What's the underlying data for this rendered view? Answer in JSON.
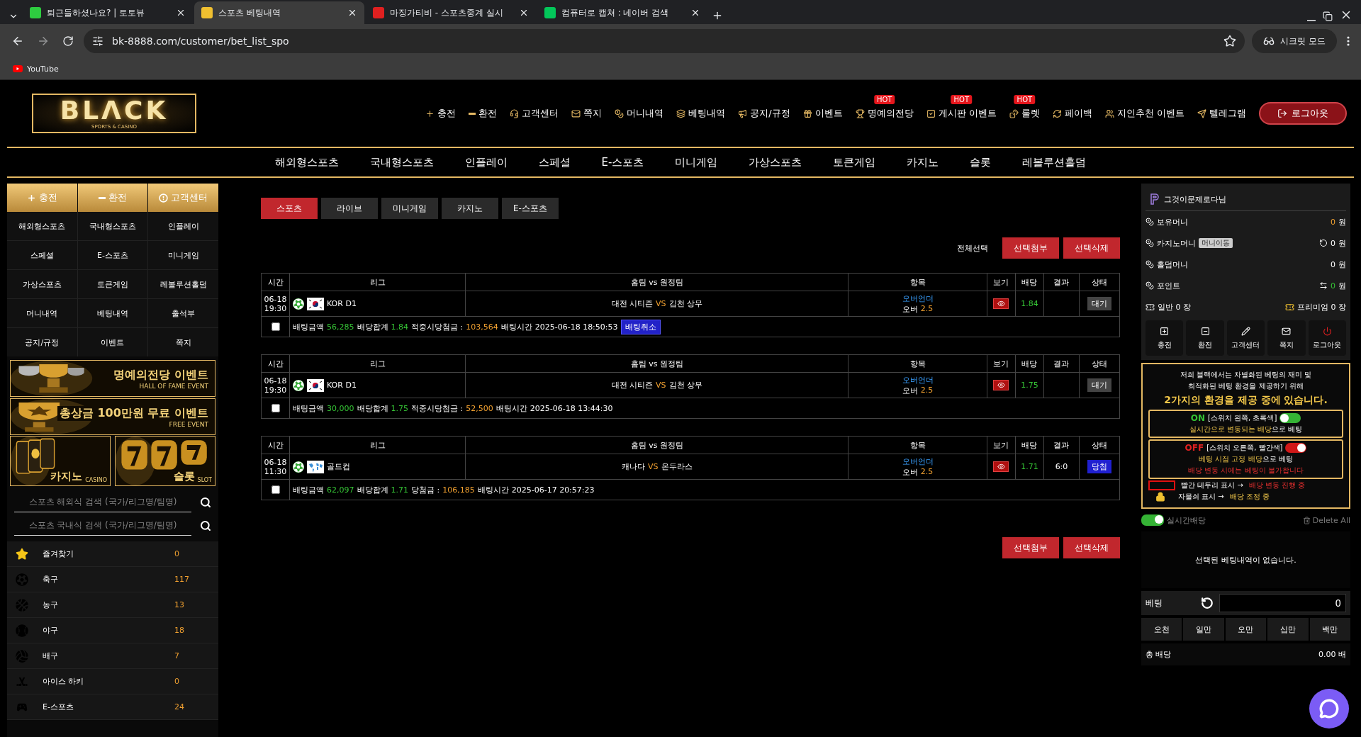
{
  "browser": {
    "tabs": [
      {
        "title": "퇴근들하셨나요? | 토토뷰",
        "selected": false
      },
      {
        "title": "스포츠 베팅내역",
        "selected": true
      },
      {
        "title": "마징가티비 - 스포츠중계 실시",
        "selected": false
      },
      {
        "title": "컴퓨터로 캡쳐 : 네이버 검색",
        "selected": false
      }
    ],
    "url": "bk-8888.com/customer/bet_list_spo",
    "profile": "시크릿 모드",
    "bookmarks": [
      "YouTube"
    ]
  },
  "header": {
    "logo": "BLΛCK",
    "logo_sub": "SPORTS & CASINO",
    "menu": [
      {
        "label": "충전"
      },
      {
        "label": "환전"
      },
      {
        "label": "고객센터"
      },
      {
        "label": "쪽지"
      },
      {
        "label": "머니내역"
      },
      {
        "label": "베팅내역"
      },
      {
        "label": "공지/규정"
      },
      {
        "label": "이벤트"
      },
      {
        "label": "명예의전당",
        "badge": "HOT"
      },
      {
        "label": "게시판 이벤트",
        "badge": "HOT"
      },
      {
        "label": "룰렛",
        "badge": "HOT"
      },
      {
        "label": "페이백"
      },
      {
        "label": "지인추천 이벤트"
      },
      {
        "label": "텔레그램"
      }
    ],
    "logout": "로그아웃",
    "nav": [
      "해외형스포츠",
      "국내형스포츠",
      "인플레이",
      "스페셜",
      "E-스포츠",
      "미니게임",
      "가상스포츠",
      "토큰게임",
      "카지노",
      "슬롯",
      "레볼루션홀덤"
    ]
  },
  "left": {
    "quick": [
      "충전",
      "환전",
      "고객센터"
    ],
    "grid": [
      "해외형스포츠",
      "국내형스포츠",
      "인플레이",
      "스페셜",
      "E-스포츠",
      "미니게임",
      "가상스포츠",
      "토큰게임",
      "레볼루션홀덤",
      "머니내역",
      "베팅내역",
      "출석부",
      "공지/규정",
      "이벤트",
      "쪽지"
    ],
    "banners": [
      {
        "title": "명예의전당 이벤트",
        "sub": "HALL OF FAME EVENT"
      },
      {
        "title": "총상금 100만원 무료 이벤트",
        "sub": "FREE EVENT"
      }
    ],
    "tiles": [
      {
        "title": "카지노",
        "sub": "CASINO"
      },
      {
        "title": "슬롯",
        "sub": "SLOT"
      }
    ],
    "searches": [
      {
        "placeholder": "스포츠 해외식 검색 (국가/리그명/팀명)"
      },
      {
        "placeholder": "스포츠 국내식 검색 (국가/리그명/팀명)"
      }
    ],
    "sports": [
      {
        "name": "즐겨찾기",
        "count": "0"
      },
      {
        "name": "축구",
        "count": "117"
      },
      {
        "name": "농구",
        "count": "13"
      },
      {
        "name": "야구",
        "count": "18"
      },
      {
        "name": "배구",
        "count": "7"
      },
      {
        "name": "아이스 하키",
        "count": "0"
      },
      {
        "name": "E-스포츠",
        "count": "24"
      }
    ]
  },
  "main": {
    "tabs": [
      {
        "label": "스포츠",
        "selected": true
      },
      {
        "label": "라이브",
        "selected": false
      },
      {
        "label": "미니게임",
        "selected": false
      },
      {
        "label": "카지노",
        "selected": false
      },
      {
        "label": "E-스포츠",
        "selected": false
      }
    ],
    "select_all": "전체선택",
    "actions": [
      "선택첨부",
      "선택삭제"
    ],
    "bets": [
      {
        "columns": [
          "시간",
          "리그",
          "홈팀 vs 원정팀",
          "항목",
          "보기",
          "배당",
          "결과",
          "상태"
        ],
        "kind": "pending",
        "flag": {
          "kind": "kr"
        },
        "date": "06-18",
        "time": "19:30",
        "league": "KOR D1",
        "home": "대전 시티즌",
        "vs": "VS",
        "away": "김천 상무",
        "market": "오버언더",
        "pick": "오버",
        "line": "2.5",
        "odds": "1.84",
        "status": "대기",
        "checked": false,
        "amount_label": "배팅금액",
        "amount": "56,285",
        "sum_label": "배당합계",
        "sum": "1.84",
        "payout_label": "적중시당첨금 :",
        "payout": "103,564",
        "time_label": "배팅시간",
        "bet_time": "2025-06-18 18:50:53",
        "cancel": "배팅취소"
      },
      {
        "columns": [
          "시간",
          "리그",
          "홈팀 vs 원정팀",
          "항목",
          "보기",
          "배당",
          "결과",
          "상태"
        ],
        "kind": "pending",
        "flag": {
          "kind": "kr"
        },
        "date": "06-18",
        "time": "19:30",
        "league": "KOR D1",
        "home": "대전 시티즌",
        "vs": "VS",
        "away": "김천 상무",
        "market": "오버언더",
        "pick": "오버",
        "line": "2.5",
        "odds": "1.75",
        "status": "대기",
        "checked": false,
        "amount_label": "배팅금액",
        "amount": "30,000",
        "sum_label": "배당합계",
        "sum": "1.75",
        "payout_label": "적중시당첨금 :",
        "payout": "52,500",
        "time_label": "배팅시간",
        "bet_time": "2025-06-18 13:44:30"
      },
      {
        "columns": [
          "시간",
          "리그",
          "홈팀 vs 원정팀",
          "항목",
          "보기",
          "배당",
          "결과",
          "상태"
        ],
        "kind": "won",
        "flag": {
          "kind": "world"
        },
        "date": "06-18",
        "time": "11:30",
        "league": "골드컵",
        "home": "캐나다",
        "vs": "VS",
        "away": "온두라스",
        "market": "오버언더",
        "pick": "오버",
        "line": "2.5",
        "odds": "1.71",
        "result": "6:0",
        "status": "당첨",
        "checked": false,
        "amount_label": "배팅금액",
        "amount": "62,097",
        "sum_label": "배당합계",
        "sum": "1.71",
        "payout_label": "당첨금 :",
        "payout": "106,185",
        "time_label": "배팅시간",
        "bet_time": "2025-06-17 20:57:23"
      }
    ],
    "bottom_actions": [
      "선택첨부",
      "선택삭제"
    ]
  },
  "right": {
    "user": "그것이문제로다님",
    "money": [
      {
        "label": "보유머니",
        "value": "0",
        "unit": "원",
        "color": "#f0a030"
      },
      {
        "label": "카지노머니",
        "badge": "머니이동",
        "value": "0",
        "unit": "원",
        "color": "#ffffff"
      },
      {
        "label": "홀덤머니",
        "value": "0",
        "unit": "원",
        "color": "#ffffff"
      },
      {
        "label": "포인트",
        "value": "0",
        "unit": "원",
        "color": "#35c335"
      }
    ],
    "tickets": [
      {
        "label": "일반 0 장"
      },
      {
        "label": "프리미엄 0 장"
      }
    ],
    "actions": [
      "충전",
      "환전",
      "고객센터",
      "쪽지",
      "로그아웃"
    ],
    "info": {
      "lines": [
        "저희 블랙에서는 차별화된 베팅의 재미 및",
        "최적화된 베팅 환경을 제공하기 위해"
      ],
      "headline": "2가지의 환경을 제공 중에 있습니다.",
      "modes": [
        {
          "kind": "left",
          "state": "ON",
          "hint": "[스위치 왼쪽, 초록색]",
          "highlight": "실시간으로 변동되는 배당",
          "rest": "으로 베팅"
        },
        {
          "kind": "right",
          "state": "OFF",
          "hint": "[스위치 오른쪽, 빨간색]",
          "highlight": "베팅 시점 고정 배당",
          "rest": "으로 베팅",
          "warning": "배당 변동 시에는 베팅이 불가합니다"
        }
      ],
      "legend": [
        {
          "text": "빨간 테두리 표시 →",
          "em": "배당 변동 진행 중"
        },
        {
          "text": "자물쇠 표시 →",
          "em": "배당 조정 중"
        }
      ]
    },
    "live_odds": {
      "label": "실시간배당",
      "on": true
    },
    "delete_all": "Delete All",
    "empty": "선택된 베팅내역이 없습니다.",
    "bet_label": "베팅",
    "bet_value": "0",
    "chips": [
      "오천",
      "일만",
      "오만",
      "십만",
      "백만"
    ],
    "total_label": "총 배당",
    "total": "0.00 배"
  }
}
